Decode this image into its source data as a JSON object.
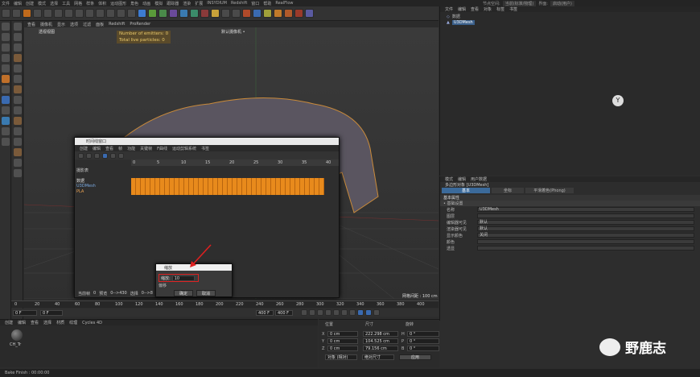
{
  "menubar": [
    "文件",
    "编辑",
    "创建",
    "模式",
    "选择",
    "工具",
    "网格",
    "样条",
    "体积",
    "运动图形",
    "角色",
    "动画",
    "模拟",
    "跟踪器",
    "渲染",
    "扩展",
    "INSYDIUM",
    "Redshift",
    "窗口",
    "帮助",
    "RealFlow"
  ],
  "layout": {
    "label": "节点空间:",
    "value": "当前(标准/物理)",
    "label2": "界面:",
    "value2": "启动(用户)"
  },
  "viewport": {
    "menu": [
      "查看",
      "摄像机",
      "显示",
      "选项",
      "过滤",
      "面板",
      "Redshift",
      "ProRender"
    ],
    "name": "透视视图",
    "camera": "默认摄像机 •",
    "hud": [
      "Number of emitters: 0",
      "Total live particles: 0"
    ],
    "grid_spacing": "网格间距 : 100 cm"
  },
  "objects": {
    "menu": [
      "文件",
      "编辑",
      "查看",
      "对象",
      "标签",
      "书签"
    ],
    "items": [
      {
        "name": "数据"
      },
      {
        "name": "U3DMesh"
      }
    ]
  },
  "attributes": {
    "menu": [
      "模式",
      "编辑",
      "用户数据"
    ],
    "object_label": "多边形对象 [U3DMesh]",
    "tabs": [
      "基本",
      "坐标",
      "平滑着色(Phong)"
    ],
    "section": "基本属性",
    "subsection": "• 基础设置",
    "rows": [
      {
        "label": "名称",
        "value": "U3DMesh"
      },
      {
        "label": "图层",
        "value": ""
      },
      {
        "label": "编辑器可见",
        "value": "默认"
      },
      {
        "label": "渲染器可见",
        "value": "默认"
      },
      {
        "label": "显示颜色",
        "value": "关闭"
      },
      {
        "label": "颜色",
        "value": ""
      },
      {
        "label": "透显",
        "value": ""
      }
    ]
  },
  "dopesheet": {
    "title": "时间线窗口",
    "menu": [
      "创建",
      "编辑",
      "查看",
      "帧",
      "功能",
      "关键帧",
      "F曲线",
      "运动剪辑系统",
      "书签"
    ],
    "ruler": [
      "0",
      "5",
      "10",
      "15",
      "20",
      "25",
      "30",
      "35",
      "40"
    ],
    "tracks_header": "摄影表",
    "tracks": [
      "数据",
      "U3DMesh",
      "PLA"
    ],
    "footer": [
      "当前帧",
      "0",
      "预览",
      "0-->430",
      "选择",
      "0-->8"
    ]
  },
  "dialog": {
    "title": "缩放",
    "label": "缩放:",
    "value": "10",
    "sub": "偏移",
    "ok": "确定",
    "cancel": "取消"
  },
  "timeline": {
    "ticks": [
      "0",
      "20",
      "40",
      "60",
      "80",
      "100",
      "120",
      "140",
      "160",
      "180",
      "200",
      "220",
      "240",
      "260",
      "280",
      "300",
      "320",
      "340",
      "360",
      "380",
      "400"
    ],
    "current": "0 F",
    "start": "0 F",
    "end": "400 F",
    "end2": "400 F"
  },
  "material_menu": [
    "创建",
    "编辑",
    "查看",
    "选择",
    "材质",
    "纹理",
    "Cycles 4D"
  ],
  "material_name": "CH_Tr",
  "coords": {
    "headers": [
      "位置",
      "尺寸",
      "旋转"
    ],
    "rows": [
      {
        "axis": "X",
        "pos": "0 cm",
        "size": "222.298 cm",
        "rot_axis": "H",
        "rot": "0 °"
      },
      {
        "axis": "Y",
        "pos": "0 cm",
        "size": "104.525 cm",
        "rot_axis": "P",
        "rot": "0 °"
      },
      {
        "axis": "Z",
        "pos": "0 cm",
        "size": "79.156 cm",
        "rot_axis": "B",
        "rot": "0 °"
      }
    ],
    "mode1": "对象 (相对)",
    "mode2": "绝对尺寸",
    "apply": "应用"
  },
  "status": "Bake Finish : 00:00:00",
  "watermark": "野鹿志"
}
